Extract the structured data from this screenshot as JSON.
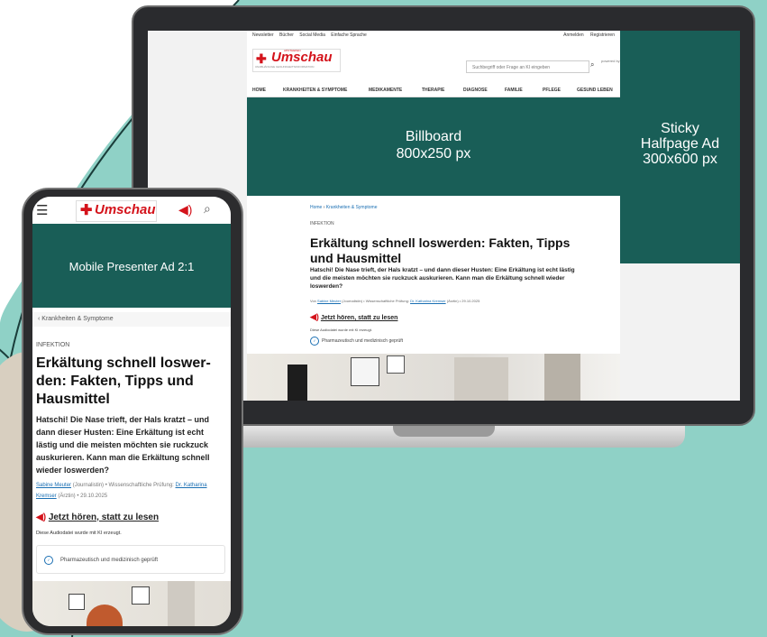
{
  "desktop": {
    "topnav": [
      "Newsletter",
      "Bücher",
      "Social Media",
      "Einfache Sprache"
    ],
    "topright": [
      "Anmelden",
      "Registrieren"
    ],
    "logo": "Umschau",
    "logo_super": "APOTHEKEN",
    "logo_sub": "UNABHÄNGIGE GESUNDHEITSINFORMATION",
    "search_placeholder": "Suchbegriff oder Frage an KI eingeben",
    "powered": "powered by",
    "categories": [
      "HOME",
      "KRANKHEITEN & SYMPTOME",
      "MEDIKAMENTE",
      "THERAPIE",
      "DIAGNOSE",
      "FAMILIE",
      "PFLEGE",
      "GESUND LEBEN"
    ],
    "billboard_line1": "Billboard",
    "billboard_line2": "800x250 px",
    "halfpage_line1": "Sticky",
    "halfpage_line2": "Halfpage Ad",
    "halfpage_line3": "300x600 px",
    "breadcrumb_home": "Home",
    "breadcrumb_cat": "Krankheiten & Symptome",
    "category": "INFEKTION",
    "title": "Erkältung schnell loswerden: Fakten, Tipps und Hausmittel",
    "lead": "Hatschi! Die Nase trieft, der Hals kratzt – und dann dieser Husten: Eine Erkältung ist echt lästig und die meisten möchten sie ruckzuck auskurieren. Kann man die Erkältung schnell wieder loswerden?",
    "meta_prefix": "Von",
    "author": "Sabine Meuter",
    "meta_mid": "(Journalistin) • Wissenschaftliche Prüfung:",
    "reviewer": "Dr. Katharina Kremser",
    "meta_end": "(Ärztin) • 29.10.2025",
    "audio_label": "Jetzt hören, statt zu lesen",
    "ai_note": "Diese Audiodatei wurde mit KI erzeugt.",
    "verified": "Pharmazeutisch und medizinisch geprüft"
  },
  "mobile": {
    "logo": "Umschau",
    "ad_label": "Mobile Presenter Ad 2:1",
    "breadcrumb": "Krankheiten & Symptome",
    "category": "INFEKTION",
    "title": "Erkältung schnell loswer-den: Fakten, Tipps und Hausmittel",
    "lead": "Hatschi! Die Nase trieft, der Hals kratzt – und dann dieser Husten: Eine Erkältung ist echt lästig und die meisten möchten sie ruckzuck auskurieren. Kann man die Erkältung schnell wieder loswerden?",
    "author": "Sabine Meuter",
    "meta_mid": "(Journalistin) • Wissenschaftliche Prüfung:",
    "reviewer": "Dr. Katharina Kremser",
    "meta_end": "(Ärztin) • 29.10.2025",
    "audio_label": "Jetzt hören, statt zu lesen",
    "ai_note": "Diese Audiodatei wurde mit KI erzeugt.",
    "verified": "Pharmazeutisch und medizinisch geprüft"
  },
  "colors": {
    "background": "#8fd1c6",
    "ad": "#195e57",
    "brand_red": "#d4131b",
    "link": "#1a6fb3"
  }
}
